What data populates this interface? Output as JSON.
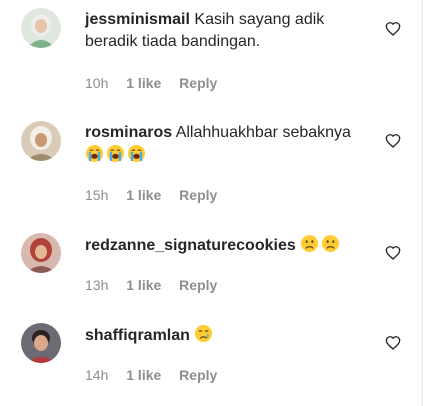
{
  "comments": [
    {
      "username": "jessminismail",
      "text": "Kasih sayang adik beradik tiada bandingan.",
      "emojis": [],
      "time": "10h",
      "likes": "1 like",
      "reply": "Reply",
      "avatar_color": "#c8ddc9"
    },
    {
      "username": "rosminaros",
      "text": "Allahhuakhbar sebaknya",
      "emojis": [
        "loudly-crying-face",
        "loudly-crying-face",
        "loudly-crying-face"
      ],
      "time": "15h",
      "likes": "1 like",
      "reply": "Reply",
      "avatar_color": "#b9a58a"
    },
    {
      "username": "redzanne_signaturecookies",
      "text": "",
      "emojis": [
        "frowning-face",
        "frowning-face"
      ],
      "time": "13h",
      "likes": "1 like",
      "reply": "Reply",
      "avatar_color": "#c7a7a0"
    },
    {
      "username": "shaffiqramlan",
      "text": "",
      "emojis": [
        "crying-face"
      ],
      "time": "14h",
      "likes": "1 like",
      "reply": "Reply",
      "avatar_color": "#7a5a57"
    }
  ],
  "colors": {
    "text": "#262626",
    "muted": "#8e8e8e",
    "emoji_yellow": "#ffcc33",
    "tear_blue": "#4fa8e8"
  }
}
